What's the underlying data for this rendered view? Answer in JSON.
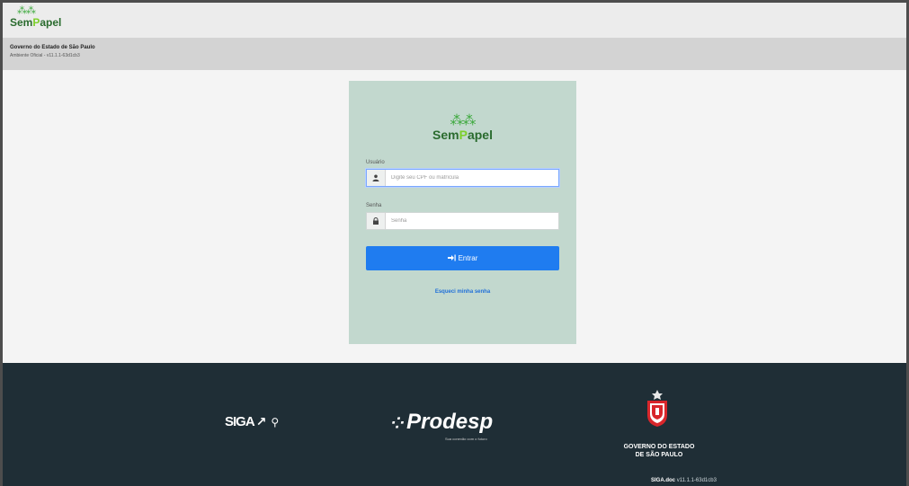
{
  "header": {
    "brand_leaves": "⁂⁂",
    "brand_sem": "Sem",
    "brand_p": "P",
    "brand_rest": "apel",
    "gov_title": "Governo do Estado de São Paulo",
    "environment": "Ambiente Oficial - v11.1.1-63d1cb3"
  },
  "login": {
    "logo_leaves": "⁂⁂",
    "logo_sem": "Sem",
    "logo_p": "P",
    "logo_rest": "apel",
    "user_label": "Usuário",
    "user_placeholder": "Digite seu CPF ou matrícula",
    "user_icon": "user-icon",
    "password_label": "Senha",
    "password_placeholder": "Senha",
    "password_icon": "lock-icon",
    "submit_icon": "sign-in-icon",
    "submit_label": "Entrar",
    "forgot_label": "Esqueci minha senha"
  },
  "footer": {
    "siga_text": "SIGA",
    "prodesp_name": "Prodesp",
    "prodesp_tagline": "Sua conexão com o futuro",
    "gov_line1": "GOVERNO DO ESTADO",
    "gov_line2": "DE SÃO PAULO",
    "version_label": "SIGA.doc",
    "version_value": "v11.1.1-63d1cb3"
  },
  "colors": {
    "card_bg": "#c2d8ce",
    "primary_button": "#1f7cf0",
    "footer_bg": "#1f2e36",
    "brand_green": "#2a6b2e",
    "brand_lime": "#7ccf2a"
  }
}
